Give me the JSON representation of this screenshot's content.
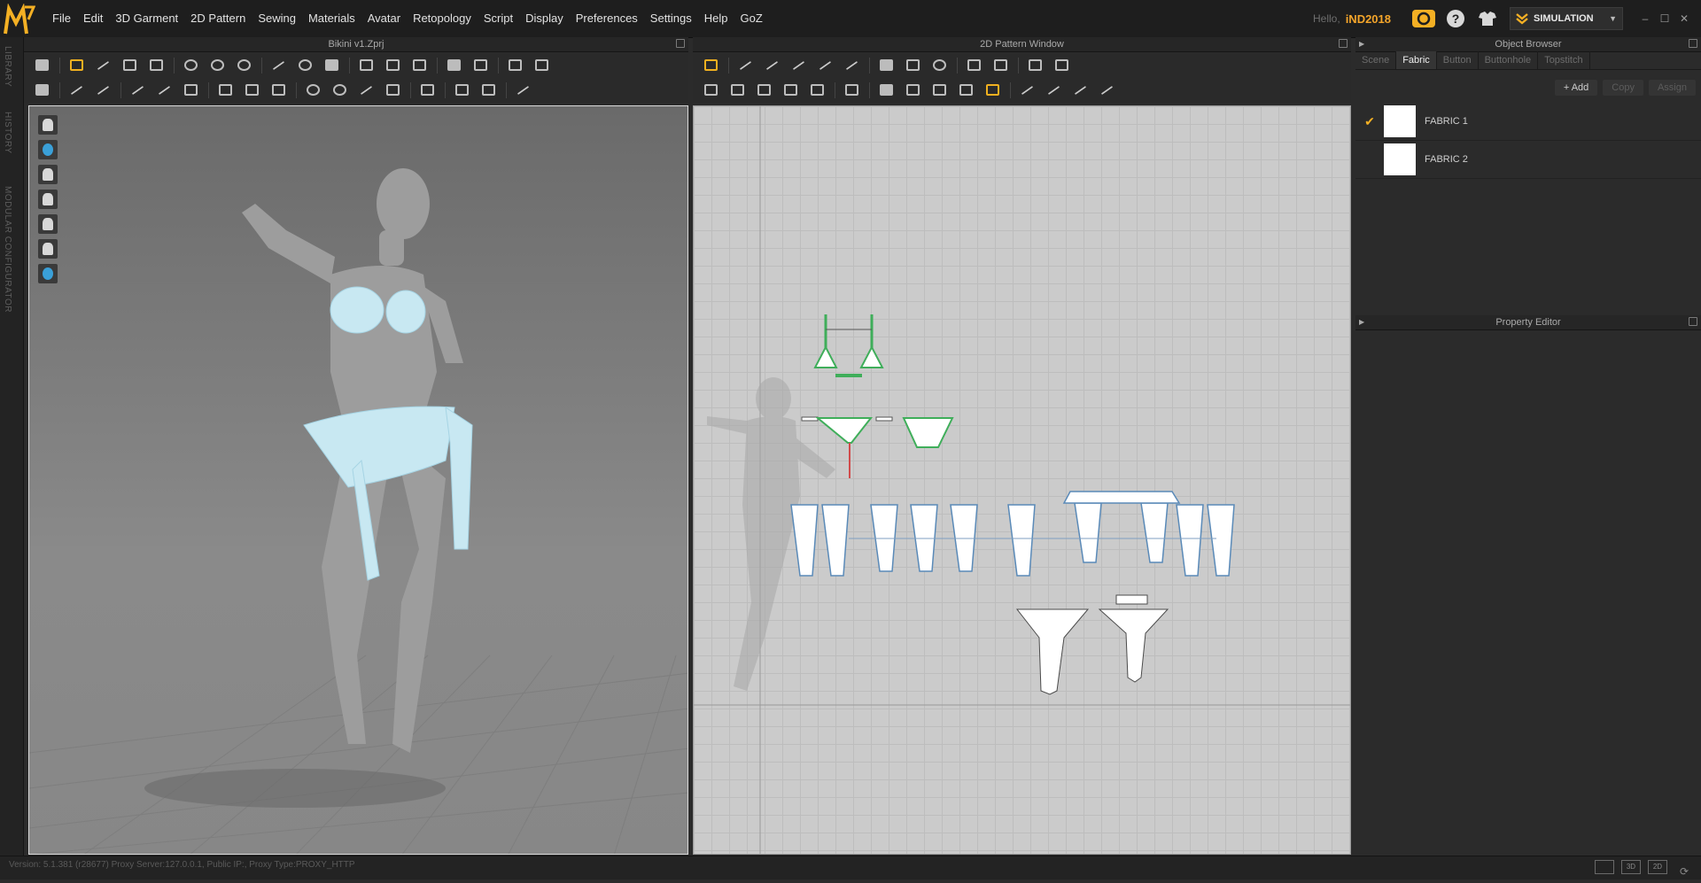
{
  "app": {
    "logo_letter": "M",
    "accent": "#f4b024"
  },
  "menu": [
    "File",
    "Edit",
    "3D Garment",
    "2D Pattern",
    "Sewing",
    "Materials",
    "Avatar",
    "Retopology",
    "Script",
    "Display",
    "Preferences",
    "Settings",
    "Help",
    "GoZ"
  ],
  "user": {
    "hello": "Hello,",
    "name": "iND2018"
  },
  "mode": {
    "label": "SIMULATION"
  },
  "left_tabs": [
    "LIBRARY",
    "HISTORY",
    "MODULAR CONFIGURATOR"
  ],
  "panels": {
    "viewport3d_title": "Bikini v1.Zprj",
    "pattern_title": "2D Pattern Window",
    "object_browser_title": "Object Browser",
    "property_editor_title": "Property Editor"
  },
  "object_browser": {
    "tabs": [
      "Scene",
      "Fabric",
      "Button",
      "Buttonhole",
      "Topstitch"
    ],
    "active_tab": "Fabric",
    "actions": {
      "add": "+ Add",
      "copy": "Copy",
      "assign": "Assign"
    },
    "fabrics": [
      {
        "name": "FABRIC 1",
        "checked": true
      },
      {
        "name": "FABRIC 2",
        "checked": false
      }
    ]
  },
  "status": {
    "text": "Version: 5.1.381 (r28677)   Proxy Server:127.0.0.1, Public IP:, Proxy Type:PROXY_HTTP"
  },
  "view_buttons": [
    "3D",
    "2D"
  ]
}
